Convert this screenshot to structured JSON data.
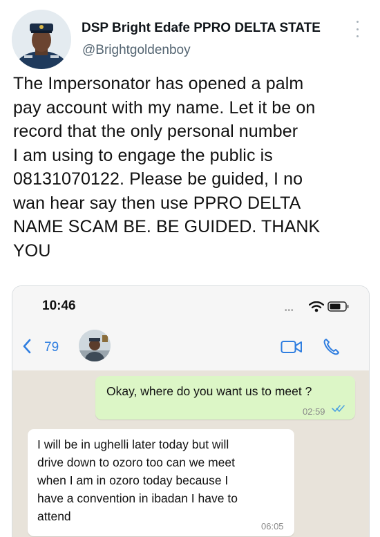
{
  "tweet": {
    "author_name": "DSP Bright Edafe PPRO DELTA STATE",
    "handle": "@Brightgoldenboy",
    "text_lines": [
      "The Impersonator has opened a palm",
      "pay account with my name. Let it be on",
      "record that the only personal number",
      "I am using to engage the public is",
      "08131070122. Please be guided, I no",
      "wan hear say then use PPRO DELTA",
      "NAME SCAM BE. BE GUIDED. THANK",
      "YOU"
    ]
  },
  "screenshot": {
    "status_time": "10:46",
    "unread_count": "79",
    "messages": [
      {
        "direction": "outgoing",
        "text": "Okay, where do you want us to meet ?",
        "time": "02:59"
      },
      {
        "direction": "incoming",
        "lines": [
          "I will be in ughelli later today but will",
          "drive down to ozoro too can we meet",
          "when I am in ozoro today because I",
          "have a convention in ibadan I have to",
          "attend"
        ],
        "time": "06:05"
      }
    ]
  },
  "icons": {
    "more": "more-vertical-icon",
    "wifi": "wifi-icon",
    "battery": "battery-icon",
    "back": "chevron-left-icon",
    "video": "video-call-icon",
    "phone": "phone-call-icon",
    "read_receipt": "double-check-icon"
  },
  "colors": {
    "link_blue": "#2f7ee0",
    "outgoing_bubble": "#dcf6c6",
    "chat_background": "#e8e3da",
    "read_ticks": "#4fa3e0"
  }
}
